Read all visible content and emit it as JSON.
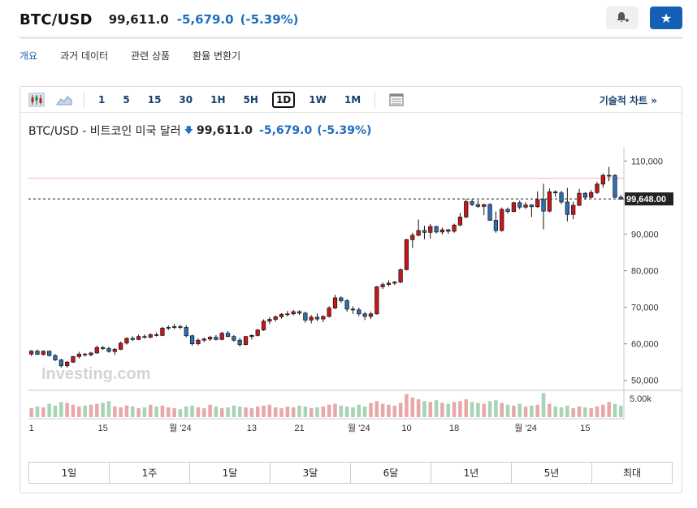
{
  "header": {
    "symbol": "BTC/USD",
    "price": "99,611.0",
    "change": "-5,679.0",
    "change_pct": "(-5.39%)"
  },
  "nav": {
    "tabs": [
      "개요",
      "과거 데이터",
      "관련 상품",
      "환율 변환기"
    ],
    "active": 0
  },
  "toolbar": {
    "timeframes": [
      "1",
      "5",
      "15",
      "30",
      "1H",
      "5H",
      "1D",
      "1W",
      "1M"
    ],
    "active_timeframe": "1D",
    "tech_chart_label": "기술적 차트 »"
  },
  "chart_title": {
    "name": "BTC/USD - 비트코인 미국 달러",
    "price": "99,611.0",
    "change": "-5,679.0",
    "change_pct": "(-5.39%)"
  },
  "watermark": "Investing.com",
  "range_buttons": [
    "1일",
    "1주",
    "1달",
    "3달",
    "6달",
    "1년",
    "5년",
    "최대"
  ],
  "colors": {
    "up": "#c8161c",
    "down": "#2e6fb5",
    "accent": "#1560b4",
    "change": "#1e6fbf",
    "last_price_line": "#f0b3b0",
    "vol_up": "#e8a8a8",
    "vol_down": "#a6d4b4"
  },
  "chart_data": {
    "type": "candlestick",
    "yaxis": {
      "ticks": [
        50000,
        60000,
        70000,
        80000,
        90000,
        110000
      ],
      "tick_labels": [
        "50,000",
        "60,000",
        "70,000",
        "80,000",
        "90,000",
        "110,000"
      ],
      "ylim": [
        47500,
        113000
      ],
      "side": "right"
    },
    "last_price_label": "99,648.00",
    "last_price": 99648,
    "high_ref_line": 105300,
    "volume_label": "5.00k",
    "x_tick_labels": [
      "1",
      "15",
      "월 '24",
      "13",
      "21",
      "월 '24",
      "10",
      "18",
      "월 '24",
      "15"
    ],
    "x_tick_index": [
      0,
      12,
      25,
      37,
      45,
      55,
      63,
      71,
      83,
      93
    ],
    "candles": [
      [
        57200,
        58300,
        56700,
        58000
      ],
      [
        58000,
        58400,
        57000,
        57100
      ],
      [
        57100,
        58200,
        56800,
        58000
      ],
      [
        58000,
        58100,
        56500,
        56800
      ],
      [
        56800,
        57200,
        55300,
        55600
      ],
      [
        55600,
        55900,
        53500,
        54000
      ],
      [
        54000,
        55300,
        53500,
        55000
      ],
      [
        55000,
        56700,
        54800,
        56500
      ],
      [
        56500,
        57800,
        56000,
        57200
      ],
      [
        57200,
        57500,
        56500,
        57000
      ],
      [
        57000,
        57800,
        56600,
        57500
      ],
      [
        57500,
        59500,
        57300,
        59000
      ],
      [
        59000,
        59400,
        58300,
        58700
      ],
      [
        58700,
        59200,
        57600,
        57900
      ],
      [
        57900,
        58900,
        57000,
        58500
      ],
      [
        58500,
        60600,
        58300,
        60200
      ],
      [
        60200,
        61800,
        59800,
        61500
      ],
      [
        61500,
        62100,
        60800,
        61200
      ],
      [
        61200,
        62500,
        61000,
        62000
      ],
      [
        62000,
        62600,
        61400,
        61800
      ],
      [
        61800,
        62900,
        61500,
        62500
      ],
      [
        62500,
        63100,
        62000,
        62300
      ],
      [
        62300,
        64700,
        62100,
        64300
      ],
      [
        64300,
        65000,
        63800,
        64500
      ],
      [
        64500,
        65400,
        64000,
        64700
      ],
      [
        64700,
        65200,
        64000,
        64500
      ],
      [
        64500,
        65100,
        61800,
        62200
      ],
      [
        62200,
        62500,
        59500,
        60000
      ],
      [
        60000,
        61500,
        59600,
        61000
      ],
      [
        61000,
        61700,
        60500,
        61300
      ],
      [
        61300,
        62200,
        60800,
        61800
      ],
      [
        61800,
        62400,
        60900,
        61200
      ],
      [
        61200,
        63300,
        61000,
        62900
      ],
      [
        62900,
        63500,
        61800,
        62000
      ],
      [
        62000,
        62400,
        60600,
        61000
      ],
      [
        61000,
        61600,
        59200,
        59800
      ],
      [
        59800,
        62200,
        59600,
        62000
      ],
      [
        62000,
        62600,
        61200,
        62300
      ],
      [
        62300,
        64100,
        62000,
        63800
      ],
      [
        63800,
        66700,
        63500,
        66200
      ],
      [
        66200,
        67300,
        65400,
        66700
      ],
      [
        66700,
        67800,
        66100,
        67400
      ],
      [
        67400,
        68400,
        66900,
        68100
      ],
      [
        68100,
        69000,
        67500,
        68200
      ],
      [
        68200,
        69300,
        67800,
        68800
      ],
      [
        68800,
        69200,
        67900,
        68400
      ],
      [
        68400,
        68800,
        65800,
        66500
      ],
      [
        66500,
        67900,
        65600,
        67300
      ],
      [
        67300,
        68300,
        66200,
        66800
      ],
      [
        66800,
        67800,
        65900,
        67500
      ],
      [
        67500,
        70300,
        67200,
        69800
      ],
      [
        69800,
        73400,
        69500,
        72600
      ],
      [
        72600,
        73000,
        71200,
        71800
      ],
      [
        71800,
        72200,
        68800,
        69500
      ],
      [
        69500,
        70300,
        68200,
        69300
      ],
      [
        69300,
        69900,
        67600,
        68200
      ],
      [
        68200,
        68700,
        66500,
        67500
      ],
      [
        67500,
        68800,
        66800,
        68200
      ],
      [
        68200,
        75800,
        68000,
        75600
      ],
      [
        75600,
        76800,
        75000,
        76200
      ],
      [
        76200,
        77400,
        75800,
        76600
      ],
      [
        76600,
        77200,
        76100,
        76900
      ],
      [
        76900,
        80600,
        76600,
        80300
      ],
      [
        80300,
        88700,
        80100,
        88500
      ],
      [
        88500,
        90400,
        86200,
        89700
      ],
      [
        89700,
        94000,
        89400,
        91000
      ],
      [
        91000,
        92300,
        88600,
        90500
      ],
      [
        90500,
        92800,
        88800,
        92100
      ],
      [
        92100,
        92300,
        90200,
        90600
      ],
      [
        90600,
        91800,
        89900,
        91200
      ],
      [
        91200,
        91500,
        90100,
        90800
      ],
      [
        90800,
        92900,
        90400,
        92500
      ],
      [
        92500,
        95800,
        92200,
        94700
      ],
      [
        94700,
        99700,
        94400,
        98900
      ],
      [
        98900,
        99600,
        97700,
        98100
      ],
      [
        98100,
        99300,
        97200,
        97600
      ],
      [
        97600,
        98300,
        95200,
        98100
      ],
      [
        98100,
        98500,
        93700,
        93800
      ],
      [
        93800,
        96200,
        90400,
        91000
      ],
      [
        91000,
        97300,
        90700,
        96800
      ],
      [
        96800,
        97300,
        95600,
        96200
      ],
      [
        96200,
        98900,
        96000,
        98600
      ],
      [
        98600,
        99200,
        96800,
        97400
      ],
      [
        97400,
        98800,
        96900,
        98000
      ],
      [
        98000,
        98200,
        94700,
        97500
      ],
      [
        97500,
        101700,
        97200,
        99500
      ],
      [
        99500,
        103800,
        91300,
        96300
      ],
      [
        96300,
        102500,
        96000,
        101600
      ],
      [
        101600,
        102000,
        100200,
        101300
      ],
      [
        101300,
        101900,
        98200,
        98800
      ],
      [
        98800,
        102700,
        93500,
        95400
      ],
      [
        95400,
        98900,
        94100,
        97900
      ],
      [
        97900,
        102400,
        97700,
        101200
      ],
      [
        101200,
        101500,
        99500,
        100100
      ],
      [
        100100,
        102100,
        99800,
        101400
      ],
      [
        101400,
        104300,
        101000,
        103700
      ],
      [
        103700,
        106600,
        102700,
        106100
      ],
      [
        106100,
        108400,
        104500,
        106100
      ],
      [
        106100,
        106400,
        99900,
        100100
      ],
      [
        100100,
        100700,
        99400,
        99610
      ]
    ],
    "volume": [
      1000,
      1200,
      1100,
      1500,
      1300,
      1700,
      1600,
      1400,
      1200,
      1300,
      1400,
      1500,
      1600,
      1800,
      1200,
      1100,
      1300,
      1200,
      1000,
      1100,
      1400,
      1200,
      1300,
      1100,
      1000,
      900,
      1200,
      1300,
      1100,
      1000,
      1400,
      1200,
      1000,
      1100,
      1300,
      1200,
      1100,
      1000,
      1200,
      1300,
      1400,
      1100,
      1000,
      1200,
      1100,
      1300,
      1200,
      1000,
      1100,
      1200,
      1400,
      1500,
      1300,
      1200,
      1100,
      1400,
      1200,
      1600,
      1800,
      1500,
      1400,
      1300,
      1600,
      2600,
      2200,
      2000,
      1800,
      1700,
      1900,
      1600,
      1500,
      1700,
      1800,
      2000,
      1700,
      1600,
      1500,
      1800,
      1900,
      1600,
      1400,
      1300,
      1500,
      1200,
      1300,
      1400,
      2700,
      1500,
      1200,
      1100,
      1300,
      1000,
      1200,
      1100,
      1000,
      1200,
      1400,
      1700,
      1500,
      1300
    ],
    "volume_dir": [
      "u",
      "d",
      "u",
      "d",
      "d",
      "d",
      "u",
      "u",
      "u",
      "d",
      "u",
      "u",
      "d",
      "d",
      "u",
      "u",
      "u",
      "d",
      "u",
      "d",
      "u",
      "d",
      "u",
      "u",
      "u",
      "d",
      "d",
      "d",
      "u",
      "u",
      "u",
      "d",
      "u",
      "d",
      "d",
      "d",
      "u",
      "u",
      "u",
      "u",
      "u",
      "u",
      "u",
      "u",
      "u",
      "d",
      "d",
      "u",
      "d",
      "u",
      "u",
      "u",
      "d",
      "d",
      "d",
      "d",
      "d",
      "u",
      "u",
      "u",
      "u",
      "u",
      "u",
      "u",
      "u",
      "u",
      "d",
      "u",
      "d",
      "u",
      "d",
      "u",
      "u",
      "u",
      "d",
      "d",
      "u",
      "d",
      "d",
      "u",
      "d",
      "u",
      "d",
      "u",
      "d",
      "u",
      "d",
      "u",
      "d",
      "d",
      "d",
      "u",
      "u",
      "d",
      "u",
      "u",
      "u",
      "u",
      "d",
      "d"
    ]
  }
}
